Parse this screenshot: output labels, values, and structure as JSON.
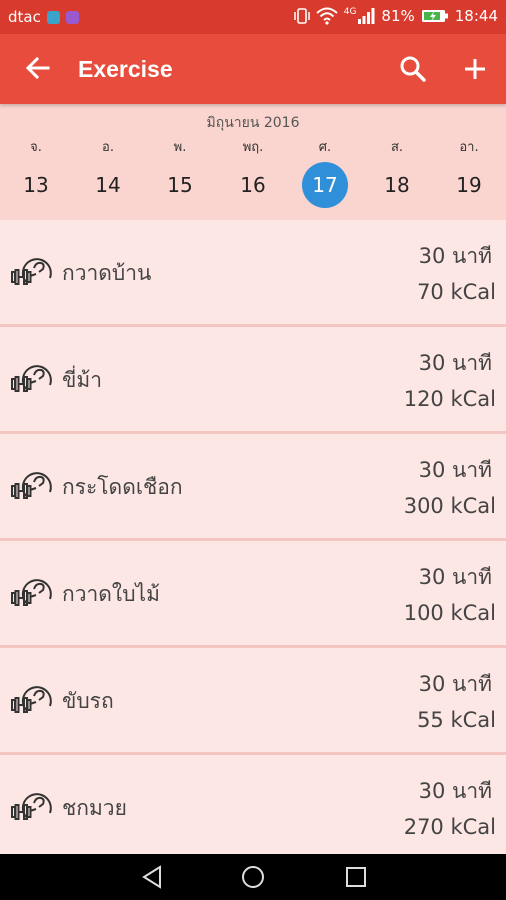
{
  "status_bar": {
    "carrier": "dtac",
    "signal": "4G",
    "battery": "81%",
    "time": "18:44"
  },
  "app_bar": {
    "title": "Exercise"
  },
  "calendar": {
    "month": "มิถุนายน 2016",
    "days": [
      {
        "dow": "จ.",
        "num": "13"
      },
      {
        "dow": "อ.",
        "num": "14"
      },
      {
        "dow": "พ.",
        "num": "15"
      },
      {
        "dow": "พฤ.",
        "num": "16"
      },
      {
        "dow": "ศ.",
        "num": "17"
      },
      {
        "dow": "ส.",
        "num": "18"
      },
      {
        "dow": "อา.",
        "num": "19"
      }
    ],
    "selected": "17"
  },
  "exercises": [
    {
      "name": "กวาดบ้าน",
      "duration": "30 นาที",
      "kcal": "70 kCal"
    },
    {
      "name": "ขี่ม้า",
      "duration": "30 นาที",
      "kcal": "120 kCal"
    },
    {
      "name": "กระโดดเชือก",
      "duration": "30 นาที",
      "kcal": "300 kCal"
    },
    {
      "name": "กวาดใบไม้",
      "duration": "30 นาที",
      "kcal": "100 kCal"
    },
    {
      "name": "ขับรถ",
      "duration": "30 นาที",
      "kcal": "55 kCal"
    },
    {
      "name": "ชกมวย",
      "duration": "30 นาที",
      "kcal": "270 kCal"
    }
  ],
  "colors": {
    "app_bar": "#e74c3c",
    "status_bar": "#d83a2e",
    "calendar_bg": "#fad4cf",
    "selected_day": "#2f8fd8",
    "list_bg": "#fde7e4"
  },
  "icons": {
    "back": "arrow-left-icon",
    "search": "search-icon",
    "add": "plus-icon",
    "exercise": "dumbbell-arm-icon"
  }
}
